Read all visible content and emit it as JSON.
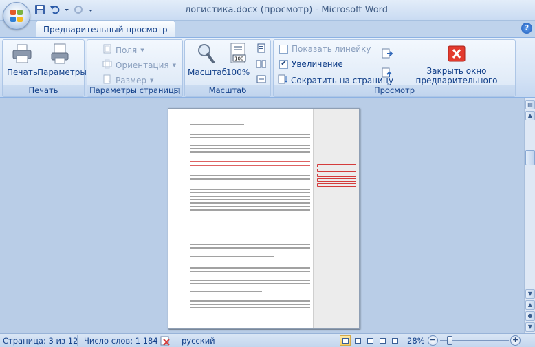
{
  "window": {
    "title": "логистика.docx (просмотр) - Microsoft Word"
  },
  "ribbon": {
    "active_tab": "Предварительный просмотр",
    "groups": {
      "print": {
        "label": "Печать",
        "print_button": "Печать",
        "options_button": "Параметры"
      },
      "page_setup": {
        "label": "Параметры страницы",
        "margins": "Поля",
        "orientation": "Ориентация",
        "size": "Размер"
      },
      "zoom": {
        "label": "Масштаб",
        "zoom_button": "Масштаб",
        "hundred_button": "100%",
        "hundred_icon_text": "100"
      },
      "preview": {
        "label": "Просмотр",
        "show_ruler": "Показать линейку",
        "show_ruler_checked": false,
        "magnifier": "Увеличение",
        "magnifier_checked": true,
        "shrink_one_page": "Сократить на страницу",
        "close_preview": "Закрыть окно предварительного просмотра"
      }
    }
  },
  "status": {
    "page": "Страница: 3 из 12",
    "words": "Число слов: 1 184",
    "language": "русский",
    "zoom_level": "28%"
  },
  "colors": {
    "ribbon_text": "#15428b",
    "close_button_red": "#e33b2f",
    "track_changes_red": "#d43b3b"
  }
}
